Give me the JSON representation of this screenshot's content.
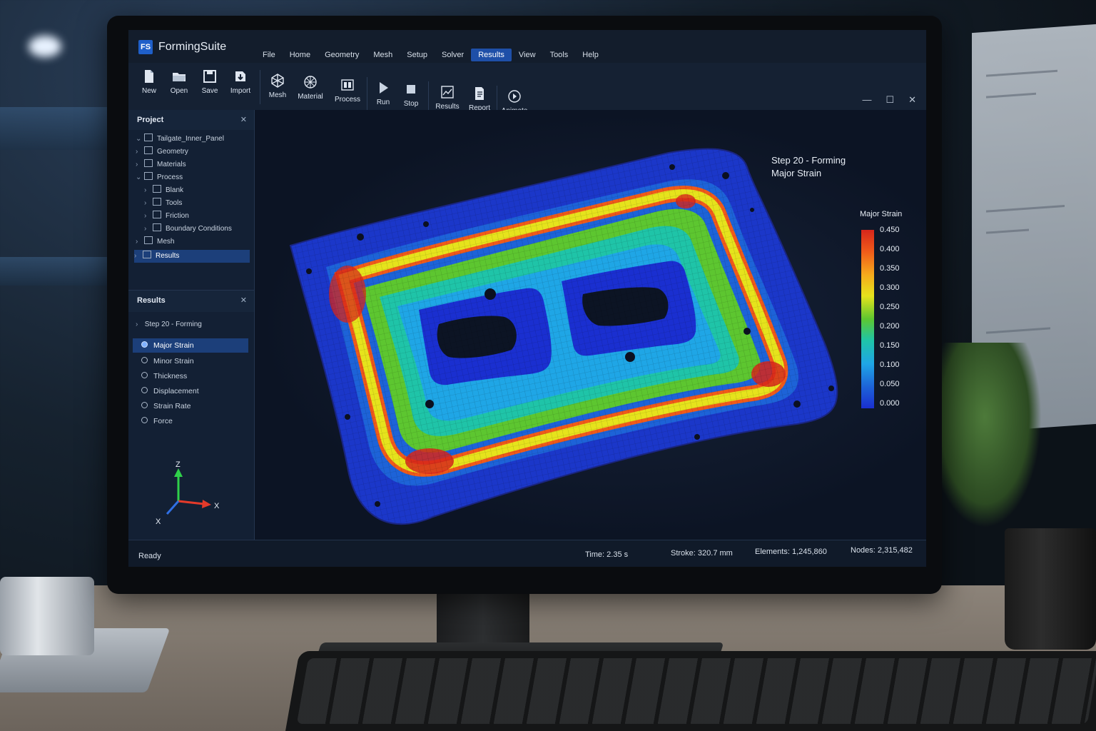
{
  "app": {
    "logo": "FS",
    "name": "FormingSuite",
    "menu": [
      "File",
      "Home",
      "Geometry",
      "Mesh",
      "Setup",
      "Solver",
      "Results",
      "View",
      "Tools",
      "Help"
    ],
    "active_menu": "Results"
  },
  "ribbon": {
    "new": "New",
    "open": "Open",
    "save": "Save",
    "import": "Import",
    "mesh": "Mesh",
    "material": "Material",
    "process": "Process",
    "run": "Run",
    "stop": "Stop",
    "results": "Results",
    "report": "Report",
    "animate": "Animate"
  },
  "window_controls": {
    "minimize": "—",
    "maximize": "☐",
    "close": "✕"
  },
  "project_panel": {
    "title": "Project",
    "close": "✕",
    "tree": [
      {
        "label": "Tailgate_Inner_Panel",
        "expanded": true
      },
      {
        "label": "Geometry"
      },
      {
        "label": "Materials"
      },
      {
        "label": "Process",
        "expanded": true
      },
      {
        "label": "Blank"
      },
      {
        "label": "Tools"
      },
      {
        "label": "Friction"
      },
      {
        "label": "Boundary Conditions"
      },
      {
        "label": "Mesh"
      },
      {
        "label": "Results",
        "selected": true
      }
    ]
  },
  "results_panel": {
    "title": "Results",
    "close": "✕",
    "step": "Step 20 - Forming",
    "items": [
      {
        "label": "Major Strain",
        "selected": true
      },
      {
        "label": "Minor Strain"
      },
      {
        "label": "Thickness"
      },
      {
        "label": "Displacement"
      },
      {
        "label": "Strain Rate"
      },
      {
        "label": "Force"
      }
    ]
  },
  "triad": {
    "z": "Z",
    "x": "X",
    "x2": "X"
  },
  "viewport": {
    "overlay_line1": "Step 20 - Forming",
    "overlay_line2": "Major Strain",
    "legend_title": "Major Strain",
    "legend_values": [
      "0.450",
      "0.400",
      "0.350",
      "0.300",
      "0.250",
      "0.200",
      "0.150",
      "0.100",
      "0.050",
      "0.000"
    ],
    "legend_colors": [
      "#d7261b",
      "#f05a1a",
      "#f6a91c",
      "#e6e31c",
      "#5dc630",
      "#1fc4a8",
      "#1fa6e6",
      "#1d63d8",
      "#1a2fd0"
    ]
  },
  "status": {
    "ready": "Ready",
    "time": "Time: 2.35 s",
    "stroke": "Stroke: 320.7 mm",
    "elements": "Elements: 1,245,860",
    "nodes": "Nodes: 2,315,482"
  }
}
